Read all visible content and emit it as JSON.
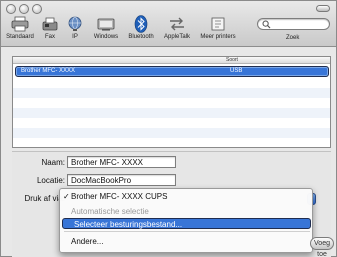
{
  "toolbar": {
    "items": [
      {
        "label": "Standaard",
        "icon": "printer-icon"
      },
      {
        "label": "Fax",
        "icon": "fax-icon"
      },
      {
        "label": "IP",
        "icon": "ip-globe-icon"
      },
      {
        "label": "Windows",
        "icon": "windows-icon"
      },
      {
        "label": "Bluetooth",
        "icon": "bluetooth-icon"
      },
      {
        "label": "AppleTalk",
        "icon": "appletalk-icon"
      },
      {
        "label": "Meer printers",
        "icon": "more-printers-icon"
      }
    ],
    "search_label": "Zoek",
    "search_placeholder": ""
  },
  "printer_list": {
    "column_kind": "Soort",
    "rows": [
      {
        "name": "Brother MFC- XXXX",
        "kind": "USB",
        "selected": true
      }
    ]
  },
  "form": {
    "name_label": "Naam:",
    "name_value": "Brother MFC- XXXX",
    "location_label": "Locatie:",
    "location_value": "DocMacBookPro",
    "print_via_label": "Druk af via:"
  },
  "popup": {
    "items": [
      {
        "label": "Brother MFC- XXXX CUPS",
        "checked": true,
        "state": "normal"
      },
      {
        "label": "Automatische selectie",
        "state": "disabled"
      },
      {
        "label": "Selecteer besturingsbestand...",
        "state": "highlight"
      },
      {
        "label": "Andere...",
        "state": "normal"
      }
    ]
  },
  "buttons": {
    "add_label": "Voeg toe"
  },
  "colors": {
    "selection": "#3875d7",
    "window_bg": "#e8e8e8"
  }
}
